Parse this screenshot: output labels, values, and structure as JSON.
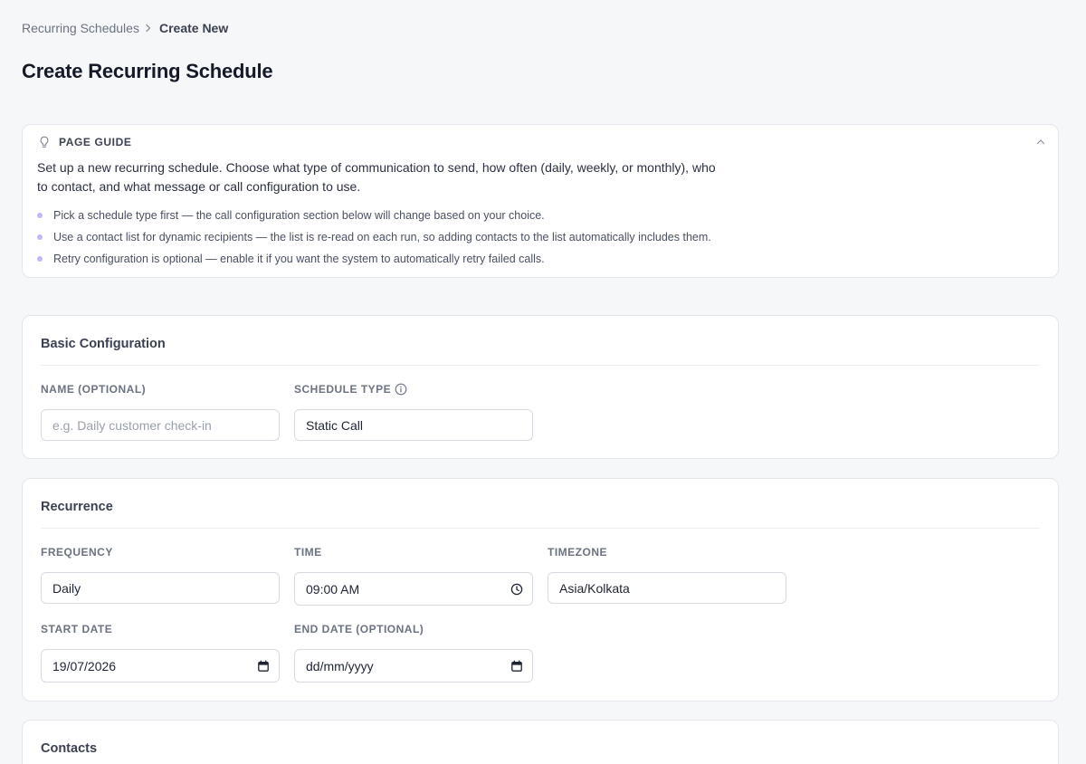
{
  "breadcrumb": {
    "parent": "Recurring Schedules",
    "current": "Create New"
  },
  "page": {
    "title": "Create Recurring Schedule"
  },
  "guide": {
    "title": "PAGE GUIDE",
    "text": "Set up a new recurring schedule. Choose what type of communication to send, how often (daily, weekly, or monthly), who to contact, and what message or call configuration to use.",
    "bullets": [
      "Pick a schedule type first — the call configuration section below will change based on your choice.",
      "Use a contact list for dynamic recipients — the list is re-read on each run, so adding contacts to the list automatically includes them.",
      "Retry configuration is optional — enable it if you want the system to automatically retry failed calls."
    ]
  },
  "basic": {
    "title": "Basic Configuration",
    "name_label": "NAME (OPTIONAL)",
    "name_placeholder": "e.g. Daily customer check-in",
    "type_label": "SCHEDULE TYPE",
    "type_value": "Static Call"
  },
  "recurrence": {
    "title": "Recurrence",
    "frequency_label": "FREQUENCY",
    "frequency_value": "Daily",
    "time_label": "TIME",
    "time_value": "09:00 AM",
    "timezone_label": "TIMEZONE",
    "timezone_value": "Asia/Kolkata",
    "start_label": "START DATE",
    "start_value": "19/07/2026",
    "end_label": "END DATE (OPTIONAL)",
    "end_placeholder": "dd/mm/yyyy"
  },
  "contacts": {
    "title": "Contacts"
  },
  "icons": {
    "crumb_sep": "chevron-right-icon",
    "guide": "lightbulb-icon",
    "collapse": "chevron-up-icon",
    "info": "info-icon",
    "clock": "clock-icon",
    "calendar": "calendar-icon"
  },
  "colors": {
    "bullet": "#c4b5fd",
    "page_bg": "#f6f7f9"
  }
}
